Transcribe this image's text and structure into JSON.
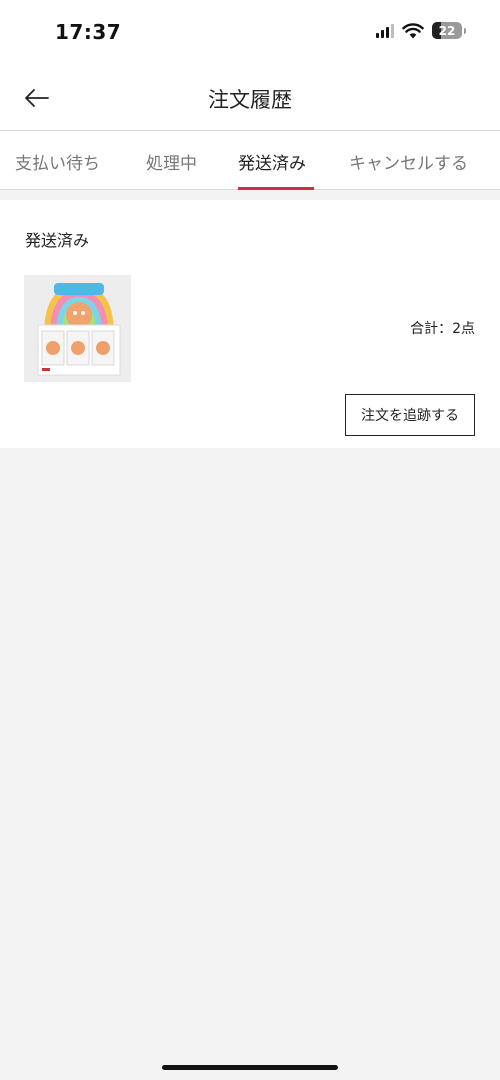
{
  "status_bar": {
    "time": "17:37",
    "battery_level": "22",
    "icons": [
      "signal-icon",
      "wifi-icon",
      "battery-icon"
    ]
  },
  "header": {
    "title": "注文履歴",
    "back_icon": "back-arrow-icon"
  },
  "tabs": [
    {
      "label": "支払い待ち",
      "active": false
    },
    {
      "label": "処理中",
      "active": false
    },
    {
      "label": "発送済み",
      "active": true
    },
    {
      "label": "キャンセルする",
      "active": false
    }
  ],
  "order": {
    "status": "発送済み",
    "total_label": "合計：2点",
    "track_button": "注文を追跡する"
  },
  "colors": {
    "accent": "#d32f3a",
    "background": "#f3f3f3",
    "card": "#ffffff"
  }
}
